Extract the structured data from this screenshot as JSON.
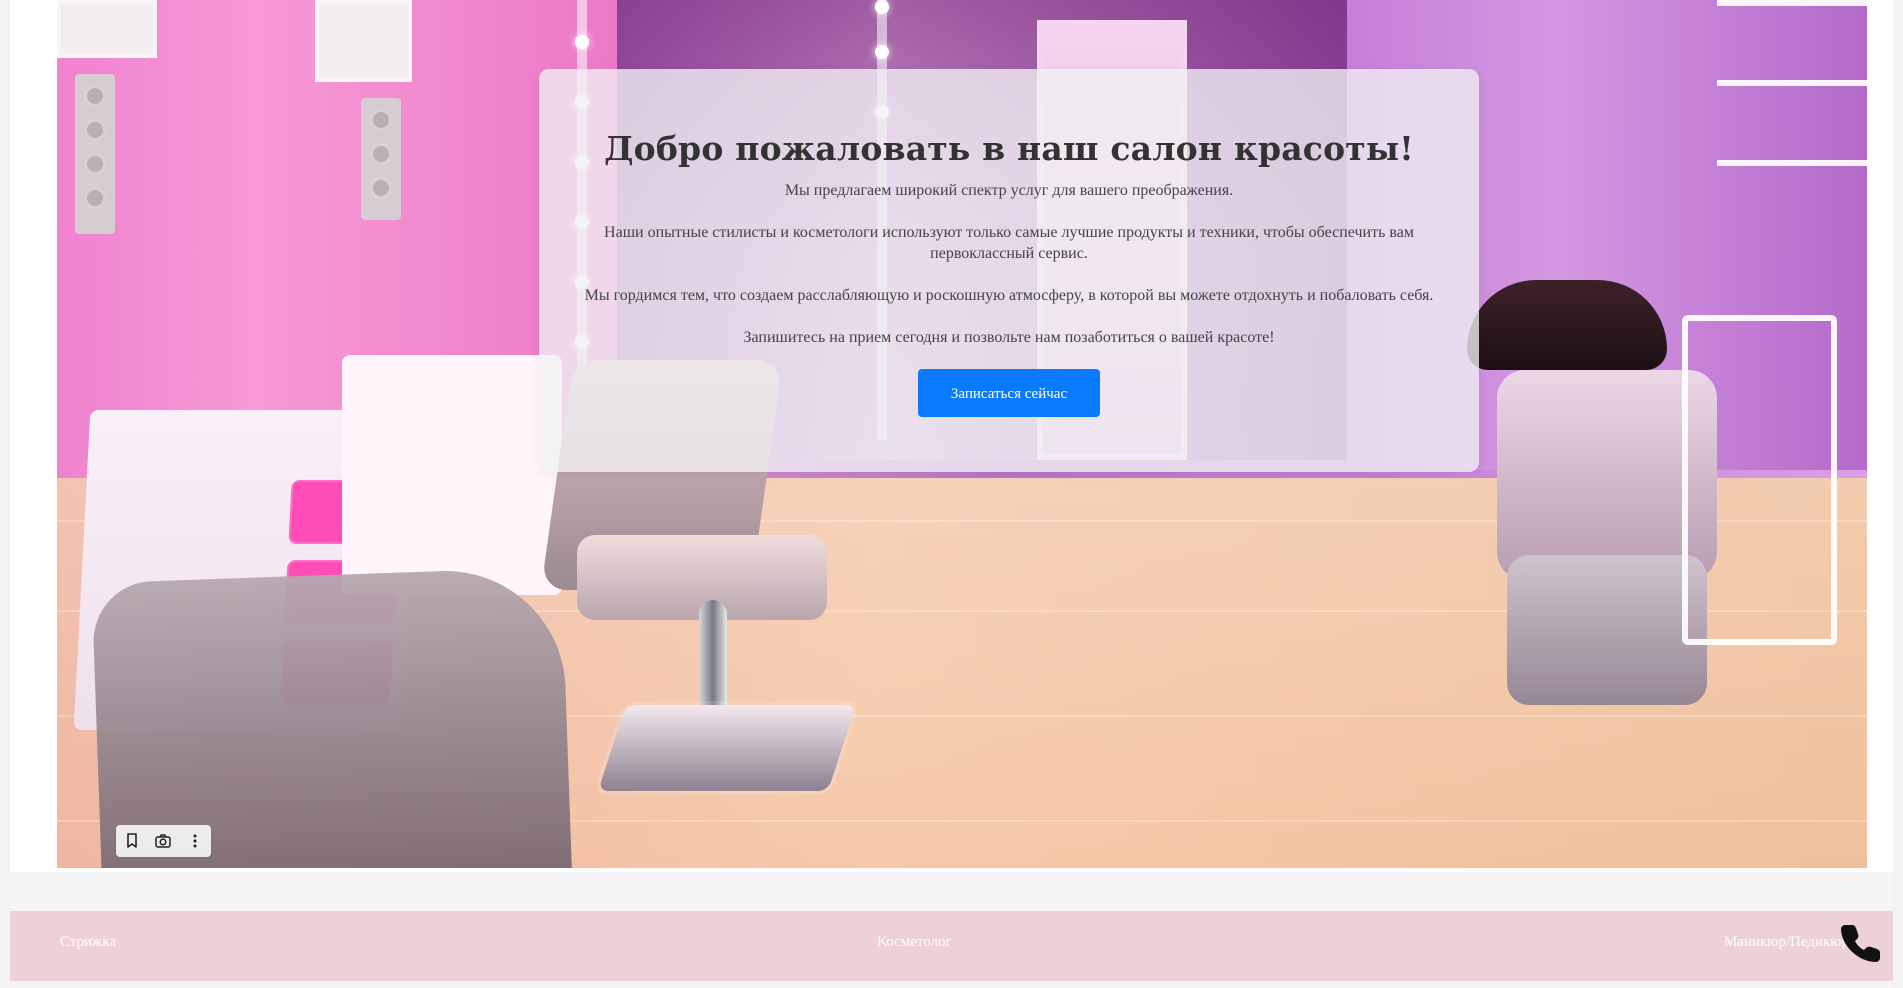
{
  "hero": {
    "title": "Добро пожаловать в наш салон красоты!",
    "paragraphs": [
      "Мы предлагаем широкий спектр услуг для вашего преображения.",
      "Наши опытные стилисты и косметологи используют только самые лучшие продукты и техники, чтобы обеспечить вам первоклассный сервис.",
      "Мы гордимся тем, что создаем расслабляющую и роскошную атмосферу, в которой вы можете отдохнуть и побаловать себя.",
      "Запишитесь на прием сегодня и позвольте нам позаботиться о вашей красоте!"
    ],
    "cta_label": "Записаться сейчас"
  },
  "bottom_nav": {
    "items": [
      "Стрижка",
      "Косметолог",
      "Маникюр/Педикюр"
    ]
  },
  "icons": {
    "bookmark": "bookmark-icon",
    "camera": "camera-icon",
    "more": "more-vertical-icon",
    "phone": "phone-icon"
  },
  "colors": {
    "primary_button": "#0a7bff",
    "bottom_bar": "#ecd1d6"
  }
}
